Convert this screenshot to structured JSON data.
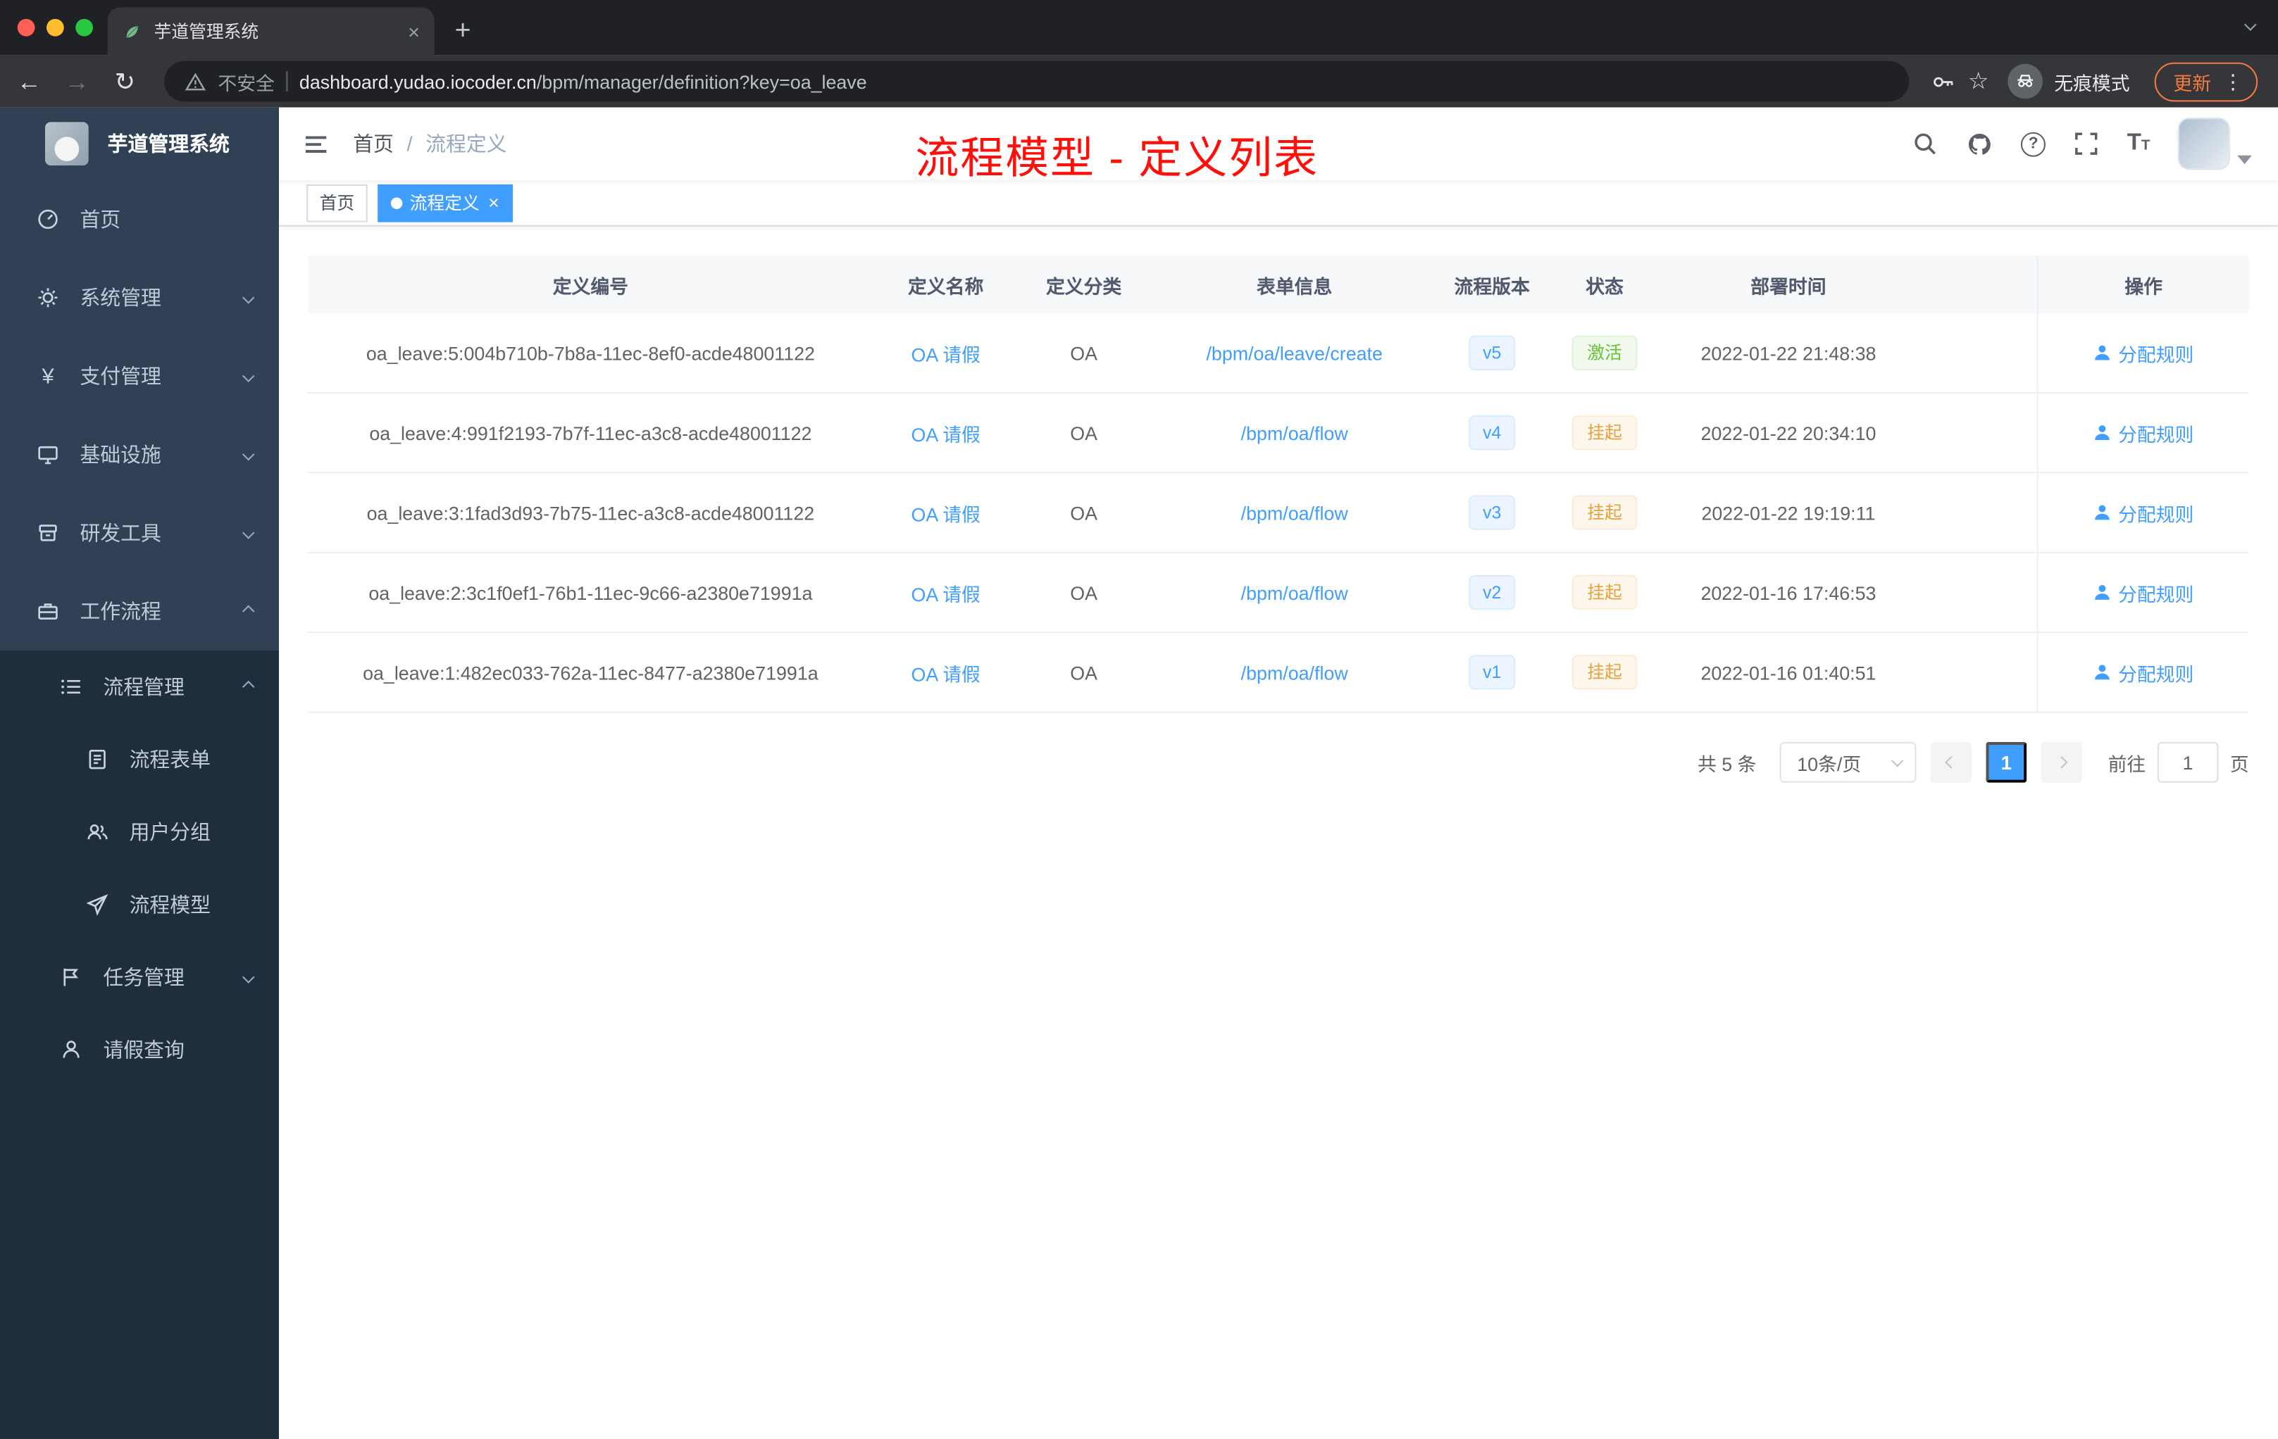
{
  "browser": {
    "tab_title": "芋道管理系统",
    "security_label": "不安全",
    "url_domain": "dashboard.yudao.iocoder.cn",
    "url_path": "/bpm/manager/definition?key=oa_leave",
    "incognito_label": "无痕模式",
    "update_label": "更新"
  },
  "icons": {
    "back": "←",
    "forward": "→",
    "reload": "↻",
    "star": "☆",
    "kebab": "⋮",
    "new_tab": "+",
    "tab_close": "×",
    "tag_close": "×",
    "yen": "¥",
    "question": "?",
    "text_size_large": "T",
    "text_size_small": "T"
  },
  "sidebar": {
    "logo_title": "芋道管理系统",
    "menu": [
      {
        "label": "首页"
      },
      {
        "label": "系统管理"
      },
      {
        "label": "支付管理"
      },
      {
        "label": "基础设施"
      },
      {
        "label": "研发工具"
      },
      {
        "label": "工作流程"
      }
    ],
    "submenu": [
      {
        "label": "流程管理"
      },
      {
        "label": "流程表单"
      },
      {
        "label": "用户分组"
      },
      {
        "label": "流程模型"
      },
      {
        "label": "任务管理"
      },
      {
        "label": "请假查询"
      }
    ]
  },
  "navbar": {
    "breadcrumb": [
      "首页",
      "流程定义"
    ],
    "separator": "/"
  },
  "annotation": "流程模型 - 定义列表",
  "tags": [
    {
      "label": "首页",
      "active": false
    },
    {
      "label": "流程定义",
      "active": true
    }
  ],
  "table": {
    "headers": [
      "定义编号",
      "定义名称",
      "定义分类",
      "表单信息",
      "流程版本",
      "状态",
      "部署时间",
      "操作"
    ],
    "rows": [
      {
        "id": "oa_leave:5:004b710b-7b8a-11ec-8ef0-acde48001122",
        "name": "OA 请假",
        "category": "OA",
        "form": "/bpm/oa/leave/create",
        "version": "v5",
        "status": "激活",
        "status_type": "success",
        "deploy_time": "2022-01-22 21:48:38",
        "action": "分配规则"
      },
      {
        "id": "oa_leave:4:991f2193-7b7f-11ec-a3c8-acde48001122",
        "name": "OA 请假",
        "category": "OA",
        "form": "/bpm/oa/flow",
        "version": "v4",
        "status": "挂起",
        "status_type": "warning",
        "deploy_time": "2022-01-22 20:34:10",
        "action": "分配规则"
      },
      {
        "id": "oa_leave:3:1fad3d93-7b75-11ec-a3c8-acde48001122",
        "name": "OA 请假",
        "category": "OA",
        "form": "/bpm/oa/flow",
        "version": "v3",
        "status": "挂起",
        "status_type": "warning",
        "deploy_time": "2022-01-22 19:19:11",
        "action": "分配规则"
      },
      {
        "id": "oa_leave:2:3c1f0ef1-76b1-11ec-9c66-a2380e71991a",
        "name": "OA 请假",
        "category": "OA",
        "form": "/bpm/oa/flow",
        "version": "v2",
        "status": "挂起",
        "status_type": "warning",
        "deploy_time": "2022-01-16 17:46:53",
        "action": "分配规则"
      },
      {
        "id": "oa_leave:1:482ec033-762a-11ec-8477-a2380e71991a",
        "name": "OA 请假",
        "category": "OA",
        "form": "/bpm/oa/flow",
        "version": "v1",
        "status": "挂起",
        "status_type": "warning",
        "deploy_time": "2022-01-16 01:40:51",
        "action": "分配规则"
      }
    ]
  },
  "pagination": {
    "total": "共 5 条",
    "page_size": "10条/页",
    "current_page": "1",
    "goto_label": "前往",
    "goto_value": "1",
    "page_unit": "页"
  },
  "colors": {
    "accent": "#409eff",
    "success": "#67c23a",
    "warning": "#e6a23c",
    "annotation_red": "#ff0f0a",
    "sidebar_bg": "#304156",
    "submenu_bg": "#1f2d3d",
    "active_tag_bg": "#409eff"
  }
}
